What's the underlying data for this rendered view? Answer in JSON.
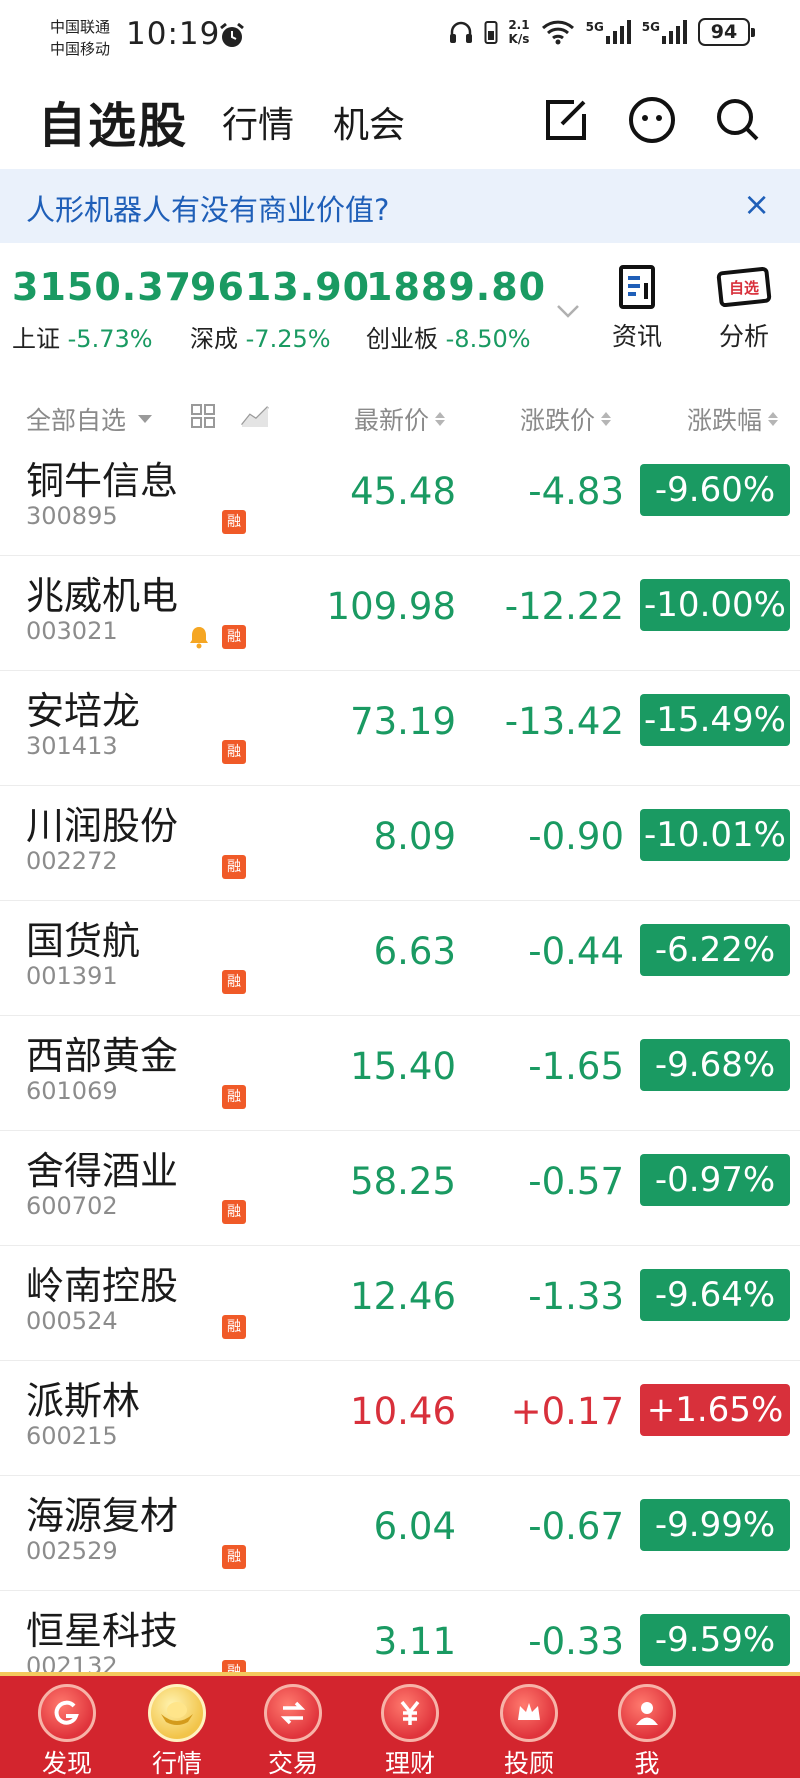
{
  "status_bar": {
    "carrier1": "中国联通",
    "carrier2": "中国移动",
    "time": "10:19",
    "net_speed_value": "2.1",
    "net_speed_unit": "K/s",
    "signal1": "5G",
    "signal2": "5G",
    "battery": "94"
  },
  "header": {
    "tabs": [
      {
        "label": "自选股",
        "active": true
      },
      {
        "label": "行情",
        "active": false
      },
      {
        "label": "机会",
        "active": false
      }
    ],
    "icons": [
      "edit-icon",
      "message-icon",
      "search-icon"
    ]
  },
  "banner": {
    "text": "人形机器人有没有商业价值?",
    "close": "×"
  },
  "indices": [
    {
      "value": "3150.37",
      "name": "上证",
      "change": "-5.73%"
    },
    {
      "value": "9613.90",
      "name": "深成",
      "change": "-7.25%"
    },
    {
      "value": "1889.80",
      "name": "创业板",
      "change": "-8.50%"
    }
  ],
  "tools": {
    "news": "资讯",
    "analysis": "分析",
    "analysis_icon_text": "自选"
  },
  "list_header": {
    "group": "全部自选",
    "price": "最新价",
    "change": "涨跌价",
    "pct": "涨跌幅"
  },
  "stocks": [
    {
      "name": "铜牛信息",
      "code": "300895",
      "price": "45.48",
      "change": "-4.83",
      "pct": "-9.60%",
      "direction": "down",
      "margin": true,
      "alert": false
    },
    {
      "name": "兆威机电",
      "code": "003021",
      "price": "109.98",
      "change": "-12.22",
      "pct": "-10.00%",
      "direction": "down",
      "margin": true,
      "alert": true
    },
    {
      "name": "安培龙",
      "code": "301413",
      "price": "73.19",
      "change": "-13.42",
      "pct": "-15.49%",
      "direction": "down",
      "margin": true,
      "alert": false
    },
    {
      "name": "川润股份",
      "code": "002272",
      "price": "8.09",
      "change": "-0.90",
      "pct": "-10.01%",
      "direction": "down",
      "margin": true,
      "alert": false
    },
    {
      "name": "国货航",
      "code": "001391",
      "price": "6.63",
      "change": "-0.44",
      "pct": "-6.22%",
      "direction": "down",
      "margin": true,
      "alert": false
    },
    {
      "name": "西部黄金",
      "code": "601069",
      "price": "15.40",
      "change": "-1.65",
      "pct": "-9.68%",
      "direction": "down",
      "margin": true,
      "alert": false
    },
    {
      "name": "舍得酒业",
      "code": "600702",
      "price": "58.25",
      "change": "-0.57",
      "pct": "-0.97%",
      "direction": "down",
      "margin": true,
      "alert": false
    },
    {
      "name": "岭南控股",
      "code": "000524",
      "price": "12.46",
      "change": "-1.33",
      "pct": "-9.64%",
      "direction": "down",
      "margin": true,
      "alert": false
    },
    {
      "name": "派斯林",
      "code": "600215",
      "price": "10.46",
      "change": "+0.17",
      "pct": "+1.65%",
      "direction": "up",
      "margin": false,
      "alert": false
    },
    {
      "name": "海源复材",
      "code": "002529",
      "price": "6.04",
      "change": "-0.67",
      "pct": "-9.99%",
      "direction": "down",
      "margin": true,
      "alert": false
    },
    {
      "name": "恒星科技",
      "code": "002132",
      "price": "3.11",
      "change": "-0.33",
      "pct": "-9.59%",
      "direction": "down",
      "margin": true,
      "alert": false
    }
  ],
  "margin_badge_label": "融",
  "bottom_nav": [
    {
      "label": "发现",
      "icon": "discover-icon",
      "active": false
    },
    {
      "label": "行情",
      "icon": "gold-ingot-icon",
      "active": true
    },
    {
      "label": "交易",
      "icon": "trade-arrows-icon",
      "active": false
    },
    {
      "label": "理财",
      "icon": "yuan-icon",
      "active": false
    },
    {
      "label": "投顾",
      "icon": "crown-icon",
      "active": false
    },
    {
      "label": "我",
      "icon": "user-icon",
      "active": false
    }
  ],
  "colors": {
    "down": "#1a9a62",
    "up": "#d8303b",
    "nav_bg": "#d3252e",
    "banner_text": "#1f5fb8",
    "margin_badge": "#f05a28"
  }
}
